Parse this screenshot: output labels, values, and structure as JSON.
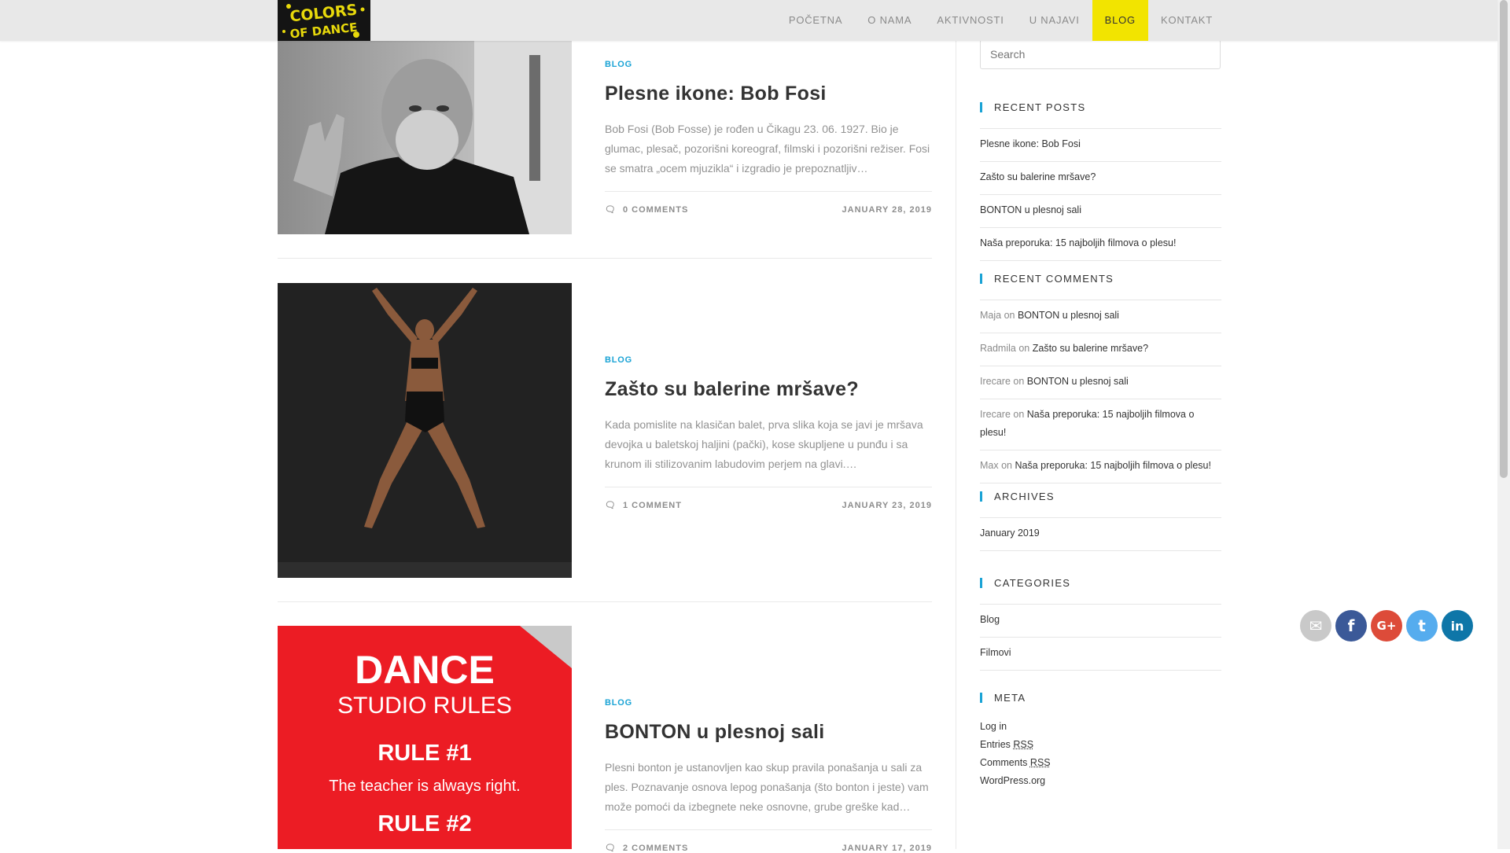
{
  "logo": {
    "text_top": "COLORS",
    "text_bottom": "OF DANCE"
  },
  "nav": [
    {
      "label": "POČETNA",
      "active": false
    },
    {
      "label": "O NAMA",
      "active": false
    },
    {
      "label": "AKTIVNOSTI",
      "active": false
    },
    {
      "label": "U NAJAVI",
      "active": false
    },
    {
      "label": "BLOG",
      "active": true
    },
    {
      "label": "KONTAKT",
      "active": false
    }
  ],
  "posts": [
    {
      "category": "BLOG",
      "title": "Plesne ikone: Bob Fosi",
      "excerpt": "Bob Fosi (Bob Fosse) je rođen u Čikagu 23. 06. 1927. Bio je glumac, plesač, pozorišni koreograf, filmski i pozorišni režiser. Fosi se smatra „ocem mjuzikla“ i izgradio je  prepoznatljiv…",
      "comments": "0 COMMENTS",
      "date": "JANUARY 28, 2019"
    },
    {
      "category": "BLOG",
      "title": "Zašto su balerine mršave?",
      "excerpt": "Kada pomislite na klasičan balet, prva slika koja se javi je mršava devojka u baletskoj haljini (pački), kose skupljene u punđu i sa krunom ili stilizovanim labudovim perjem na glavi.…",
      "comments": "1 COMMENT",
      "date": "JANUARY 23, 2019"
    },
    {
      "category": "BLOG",
      "title": "BONTON u plesnoj sali",
      "excerpt": "Plesni bonton je ustanovljen kao skup pravila ponašanja u sali za ples. Poznavanje osnova lepog ponašanja (što bonton i jeste) vam može pomoći da izbegnete neke osnovne, grube greške kad…",
      "comments": "2 COMMENTS",
      "date": "JANUARY 17, 2019",
      "image_text": {
        "l1": "DANCE",
        "l2": "STUDIO RULES",
        "l3": "RULE #1",
        "l4": "The teacher is always right.",
        "l5": "RULE #2"
      }
    }
  ],
  "search": {
    "placeholder": "Search"
  },
  "widgets": {
    "recent_posts": {
      "title": "RECENT POSTS",
      "items": [
        "Plesne ikone: Bob Fosi",
        "Zašto su balerine mršave?",
        "BONTON u plesnoj sali",
        "Naša preporuka: 15 najboljih filmova o plesu!"
      ]
    },
    "recent_comments": {
      "title": "RECENT COMMENTS",
      "on": "on",
      "items": [
        {
          "author": "Maja",
          "post": "BONTON u plesnoj sali"
        },
        {
          "author": "Radmila",
          "post": "Zašto su balerine mršave?"
        },
        {
          "author": "Irecare",
          "post": "BONTON u plesnoj sali"
        },
        {
          "author": "Irecare",
          "post": "Naša preporuka: 15 najboljih filmova o plesu!"
        },
        {
          "author": "Max",
          "post": "Naša preporuka: 15 najboljih filmova o plesu!"
        }
      ]
    },
    "archives": {
      "title": "ARCHIVES",
      "items": [
        "January 2019"
      ]
    },
    "categories": {
      "title": "CATEGORIES",
      "items": [
        "Blog",
        "Filmovi"
      ]
    },
    "meta": {
      "title": "META",
      "items": [
        "Log in",
        "Entries",
        "Comments",
        "WordPress.org"
      ],
      "rss": "RSS"
    }
  },
  "social": [
    {
      "name": "email",
      "color": "#c9c9c9",
      "glyph": "✉"
    },
    {
      "name": "facebook",
      "color": "#3b5998",
      "glyph": "f"
    },
    {
      "name": "google-plus",
      "color": "#dd4b39",
      "glyph": "G+"
    },
    {
      "name": "twitter",
      "color": "#55acee",
      "glyph": "t"
    },
    {
      "name": "linkedin",
      "color": "#0e76a8",
      "glyph": "in"
    }
  ],
  "colors": {
    "accent": "#1aa3d5",
    "nav_active": "#f2e400",
    "header_bg": "#e8e8e8"
  }
}
